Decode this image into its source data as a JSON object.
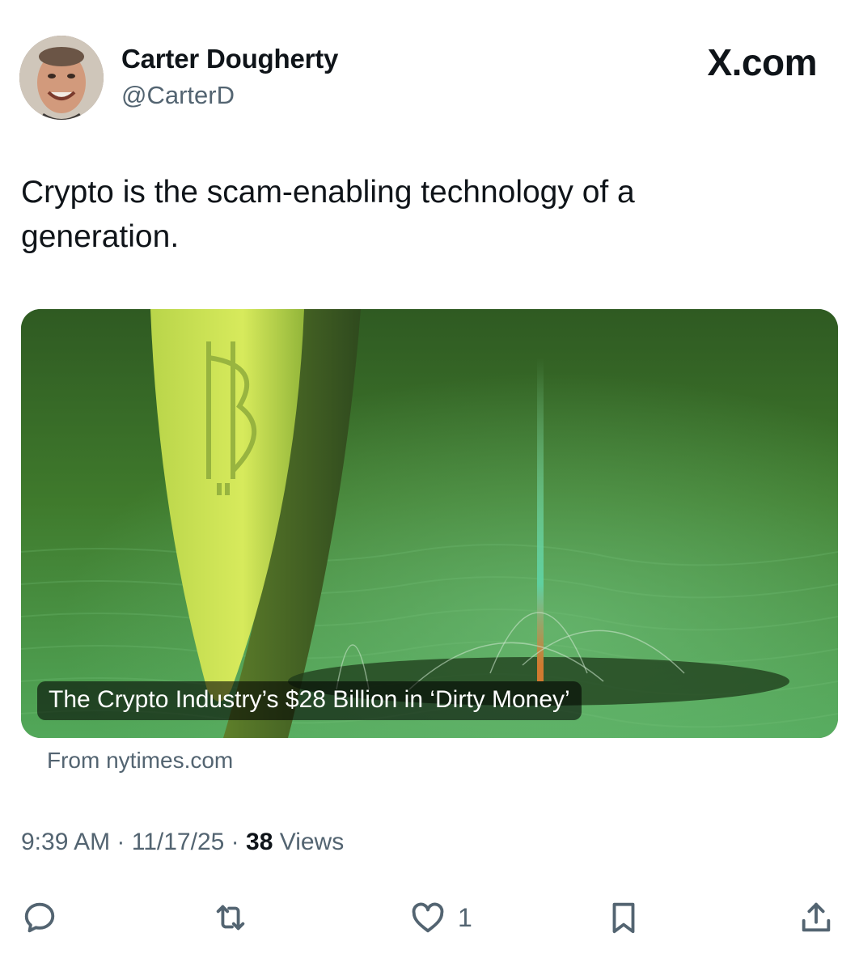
{
  "header": {
    "author_name": "Carter Dougherty",
    "author_handle": "@CarterD",
    "brand": "X.com"
  },
  "tweet": {
    "text": "Crypto is the scam-enabling technology of a generation."
  },
  "card": {
    "headline": "The Crypto Industry’s $28 Billion in ‘Dirty Money’",
    "source": "From nytimes.com"
  },
  "meta": {
    "time": "9:39 AM",
    "date": "11/17/25",
    "views_count": "38",
    "views_label": "Views",
    "separator": "·"
  },
  "actions": {
    "reply_icon": "reply-icon",
    "repost_icon": "repost-icon",
    "like_icon": "heart-icon",
    "like_count": "1",
    "bookmark_icon": "bookmark-icon",
    "share_icon": "share-icon",
    "icon_color": "#536471"
  }
}
